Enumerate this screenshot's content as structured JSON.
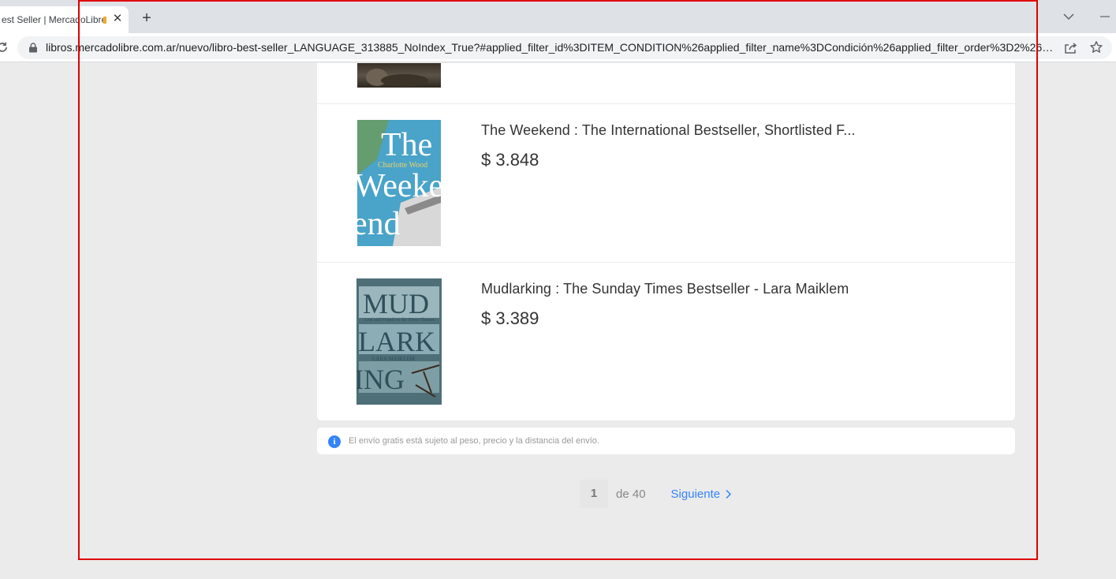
{
  "browser": {
    "tab_title": "est Seller | MercadoLibre",
    "tab_close": "✕",
    "new_tab": "+",
    "url": "libros.mercadolibre.com.ar/nuevo/libro-best-seller_LANGUAGE_313885_NoIndex_True?#applied_filter_id%3DITEM_CONDITION%26applied_filter_name%3DCondición%26applied_filter_order%3D2%26applie..."
  },
  "results": [
    {
      "title": "The Weekend : The International Bestseller, Shortlisted F...",
      "price": "$ 3.848",
      "cover": {
        "line1": "The",
        "author": "Charlotte Wood",
        "line2": "Weeke",
        "line3": "end",
        "bg": "#4aa3c9"
      }
    },
    {
      "title": "Mudlarking : The Sunday Times Bestseller - Lara Maiklem",
      "price": "$ 3.389",
      "cover": {
        "line1": "MUD",
        "subtitle": "Lost and Found on the River Thames",
        "line2": "LARK",
        "author": "LARA MAIKLEM",
        "line3": "ING",
        "bg": "#5a7f8a"
      }
    }
  ],
  "notice": {
    "icon": "i",
    "text": "El envío gratis está sujeto al peso, precio y la distancia del envío."
  },
  "pagination": {
    "current": "1",
    "of_text": "de 40",
    "next_label": "Siguiente"
  },
  "colors": {
    "link": "#3483fa",
    "background": "#ebebeb",
    "frame": "#e00000"
  }
}
